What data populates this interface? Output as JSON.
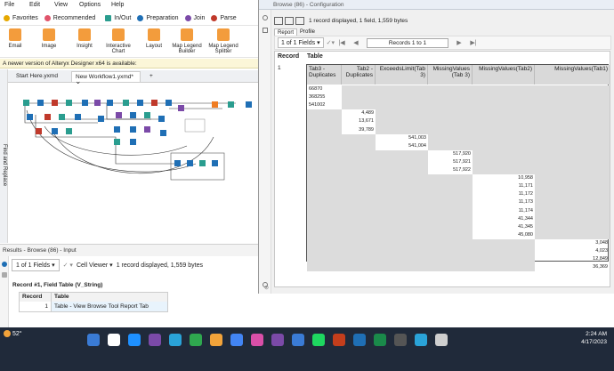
{
  "menu": [
    "File",
    "Edit",
    "View",
    "Options",
    "Help"
  ],
  "favorites": [
    {
      "label": "Favorites",
      "color": "#e6a800"
    },
    {
      "label": "Recommended",
      "color": "#e0546b"
    },
    {
      "label": "In/Out",
      "color": "#2a9d8f"
    },
    {
      "label": "Preparation",
      "color": "#1f6fb5"
    },
    {
      "label": "Join",
      "color": "#7b4aa8"
    },
    {
      "label": "Parse",
      "color": "#c0392b"
    }
  ],
  "tools": [
    {
      "label": "Email",
      "color": "#ef7c22"
    },
    {
      "label": "Image",
      "color": "#ef7c22"
    },
    {
      "label": "Insight",
      "color": "#ef7c22"
    },
    {
      "label": "Interactive Chart",
      "color": "#ef7c22"
    },
    {
      "label": "Layout",
      "color": "#ef7c22"
    },
    {
      "label": "Map Legend Builder",
      "color": "#ef7c22"
    },
    {
      "label": "Map Legend Splitter",
      "color": "#ef7c22"
    }
  ],
  "notice": "A newer version of Alteryx Designer x64 is available:",
  "doc_tabs": [
    "Start Here.yxmd",
    "New Workflow1.yxmd*"
  ],
  "sidebar_label": "Find and Replace",
  "results": {
    "header": "Results - Browse (86) - Input",
    "fields": "1 of 1 Fields",
    "viewer": "Cell Viewer",
    "info": "1 record displayed, 1,559 bytes",
    "record_line": "Record #1, Field Table (V_String)",
    "columns": [
      "Record",
      "Table"
    ],
    "rows": [
      [
        "1",
        "Table - View Browse Tool Report Tab"
      ]
    ]
  },
  "browse": {
    "title": "Browse (86) - Configuration",
    "info": "1 record displayed, 1 field, 1,559 bytes",
    "tabs": [
      "Report",
      "Profile"
    ],
    "fields": "1 of 1 Fields",
    "records": "Records 1 to 1",
    "grid_headers": [
      "Record",
      "Table"
    ],
    "record_num": "1",
    "inner_headers": [
      "Tab3 - Duplicates",
      "Tab2 - Duplicates",
      "ExceedsLimit(Tab 3)",
      "MissingValues (Tab 3)",
      "MissingValues(Tab2)",
      "MissingValues(Tab1)"
    ],
    "col0": [
      "66870",
      "368255",
      "541002"
    ],
    "col1": [
      "4,489",
      "13,671",
      "39,789"
    ],
    "col2": [
      "541,003",
      "541,004"
    ],
    "col3": [
      "517,920",
      "517,921",
      "517,922"
    ],
    "col4": [
      "10,958",
      "11,171",
      "11,172",
      "11,173",
      "11,174",
      "41,344",
      "41,345",
      "45,080"
    ],
    "col5": [
      "3,048",
      "4,023",
      "12,849",
      "36,369"
    ]
  },
  "taskbar": {
    "temp": "52°",
    "time": "2:24 AM",
    "date": "4/17/2023"
  }
}
